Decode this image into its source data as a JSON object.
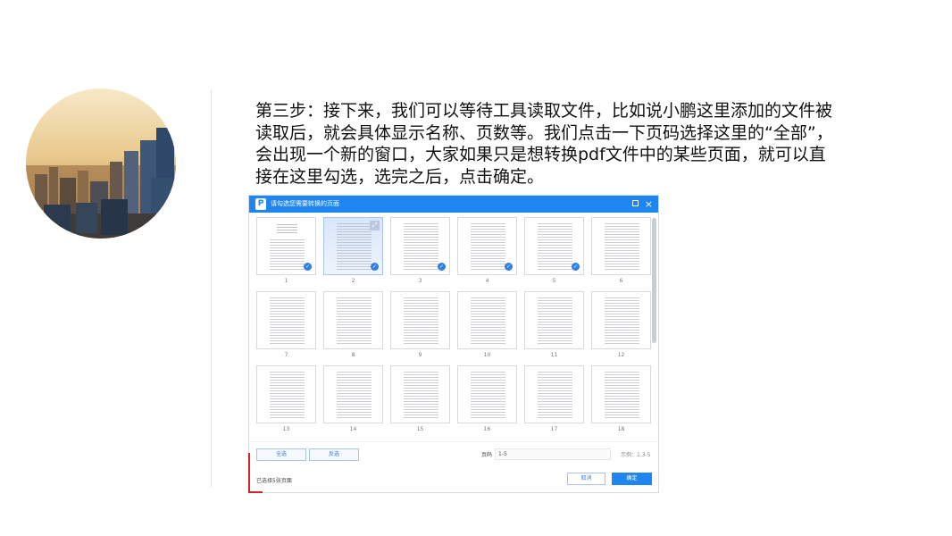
{
  "instruction": {
    "lines": [
      "第三步：接下来，我们可以等待工具读取文件，比如说小鹏这里添加的文件被",
      "读取后，就会具体显示名称、页数等。我们点击一下页码选择这里的“全部”，",
      "会出现一个新的窗口，大家如果只是想转换pdf文件中的某些页面，就可以直",
      "接在这里勾选，选完之后，点击确定。"
    ]
  },
  "dialog": {
    "title": "请勾选您需要转换的页面",
    "logo_letter": "P",
    "close_glyph": "×",
    "pages": [
      "1",
      "2",
      "3",
      "4",
      "5",
      "6",
      "7",
      "8",
      "9",
      "10",
      "11",
      "12",
      "13",
      "14",
      "15",
      "16",
      "17",
      "18"
    ],
    "checked_pages": [
      "1",
      "2",
      "3",
      "4",
      "5"
    ],
    "select_all_label": "全选",
    "invert_label": "反选",
    "pages_label": "页码",
    "pages_value": "1-5",
    "example_label": "示例：1,3-5",
    "selected_pages_label": "已选择5张页面",
    "cancel_label": "取消",
    "ok_label": "确定"
  },
  "colors": {
    "accent": "#1e86ee",
    "marker": "#d02323"
  },
  "icons": {
    "app_logo": "pdf-app-logo-icon",
    "maximize": "maximize-icon",
    "close": "close-icon",
    "check": "check-circle-icon",
    "expand": "expand-icon"
  }
}
